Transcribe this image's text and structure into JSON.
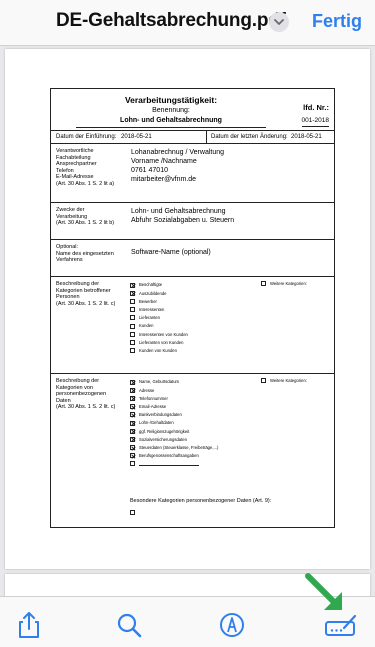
{
  "header": {
    "title": "DE-Gehaltsabrechung.pdf",
    "done_label": "Fertig"
  },
  "form": {
    "title": "Verarbeitungstätigkeit:",
    "naming_label": "Benennung:",
    "naming_value": "Lohn- und Gehaltsabrechnung",
    "lfd_label": "lfd. Nr.:",
    "lfd_value": "001-2018",
    "intro_date_label": "Datum der Einführung:",
    "intro_date_value": "2018-05-21",
    "last_change_label": "Datum der letzten Änderung:",
    "last_change_value": "2018-05-21",
    "contact_labels": [
      "Verantwortliche",
      "Fachabteilung",
      "Ansprechpartner",
      "Telefon",
      "E-Mail-Adresse",
      "(Art. 30 Abs. 1 S. 2 lit a)"
    ],
    "contact_values": [
      "Lohanabrechnug / Verwaltung",
      "Vorname /Nachname",
      "0761 47010",
      "mitarbeiter@vfnm.de"
    ],
    "purpose_labels": [
      "Zwecke der",
      "Verarbeitung",
      "(Art. 30 Abs. 1 S. 2 lit b)"
    ],
    "purpose_values": [
      "Lohn- und Gehaltsabrechnung",
      "Abfuhr Sozialabgaben u. Steuern"
    ],
    "software_labels": [
      "Optional:",
      "Name des eingesetzten",
      "Verfahrens"
    ],
    "software_value": "Software-Name (optional)",
    "persons_labels": [
      "Beschreibung der",
      "Kategorien betroffener",
      "Personen",
      "(Art. 30 Abs. 1 S. 2 lit. c)"
    ],
    "persons_items": [
      {
        "label": "Beschäftigte",
        "checked": true
      },
      {
        "label": "Auszubildende",
        "checked": true
      },
      {
        "label": "Bewerber",
        "checked": false
      },
      {
        "label": "Interessenten",
        "checked": false
      },
      {
        "label": "Lieferanten",
        "checked": false
      },
      {
        "label": "Kunden",
        "checked": false
      },
      {
        "label": "Interessenten von Kunden",
        "checked": false
      },
      {
        "label": "Lieferanten von Kunden",
        "checked": false
      },
      {
        "label": "Kunden von Kunden",
        "checked": false
      }
    ],
    "further_categories_label": "Weitere Kategorien:",
    "data_labels": [
      "Beschreibung der",
      "Kategorien von",
      "personenbezogenen",
      "Daten",
      "(Art. 30 Abs. 1 S. 2 lit. c)"
    ],
    "data_items": [
      {
        "label": "Name, Geburtsdatum",
        "checked": true
      },
      {
        "label": "Adresse",
        "checked": true
      },
      {
        "label": "Telefonnummer",
        "checked": true
      },
      {
        "label": "Email-Adresse",
        "checked": true
      },
      {
        "label": "Bankverbindungsdaten",
        "checked": true
      },
      {
        "label": "Lohn-/Gehaltdaten",
        "checked": true
      },
      {
        "label": "ggf. Religionszugehörigkeit",
        "checked": true
      },
      {
        "label": "Sozialversicherungsdaten",
        "checked": true
      },
      {
        "label": "Steuerdaten (Steuerklasse, Freibeträge,...)",
        "checked": true
      },
      {
        "label": "Berufsgenossenschaftsangaben",
        "checked": true
      },
      {
        "label": "",
        "checked": false
      }
    ],
    "special_categories_label": "Besondere Kategorien personenbezogener Daten (Art. 9):"
  },
  "toolbar": {
    "icons": [
      "share-icon",
      "search-icon",
      "markup-icon",
      "signature-icon"
    ]
  },
  "colors": {
    "accent": "#2f80ed",
    "annotation_arrow": "#2fa84f"
  }
}
